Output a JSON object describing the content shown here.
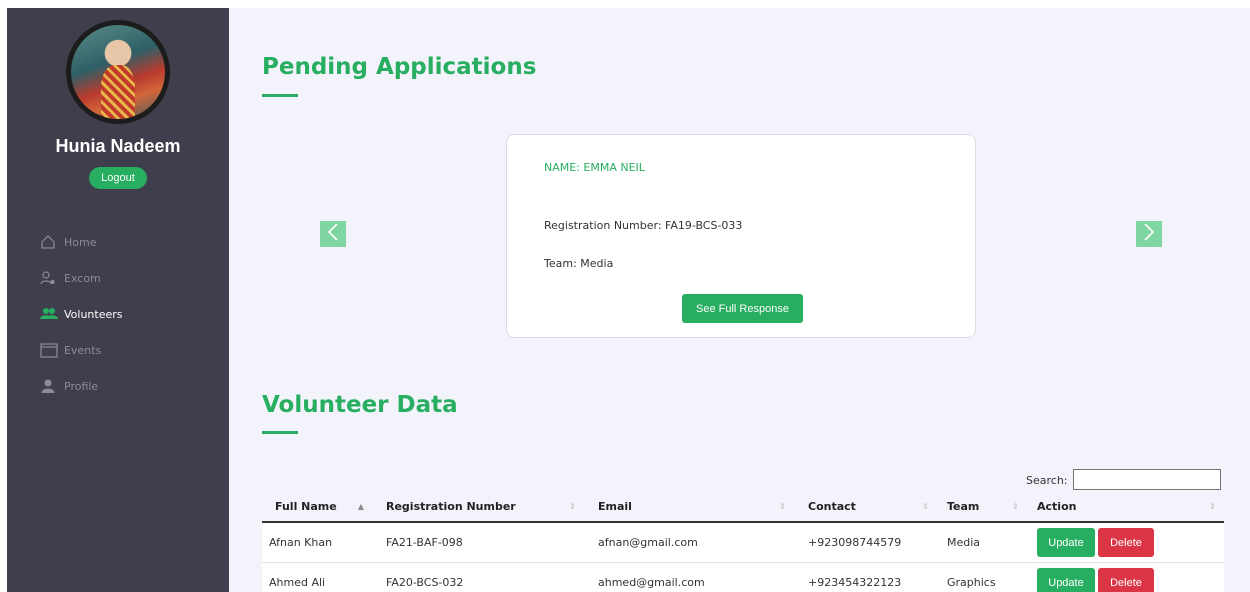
{
  "sidebar": {
    "user_name": "Hunia Nadeem",
    "logout_label": "Logout",
    "nav": [
      {
        "label": "Home",
        "icon": "home-icon",
        "active": false
      },
      {
        "label": "Excom",
        "icon": "users-gear-icon",
        "active": false
      },
      {
        "label": "Volunteers",
        "icon": "group-icon",
        "active": true
      },
      {
        "label": "Events",
        "icon": "calendar-icon",
        "active": false
      },
      {
        "label": "Profile",
        "icon": "user-icon",
        "active": false
      }
    ]
  },
  "pending": {
    "title": "Pending Applications",
    "card": {
      "name": "NAME: EMMA NEIL",
      "registration": "Registration Number: FA19-BCS-033",
      "team": "Team: Media",
      "button_label": "See Full Response"
    },
    "prev_icon": "chevron-left-icon",
    "next_icon": "chevron-right-icon"
  },
  "volunteers": {
    "title": "Volunteer Data",
    "search_label": "Search:",
    "search_value": "",
    "columns": [
      "Full Name",
      "Registration Number",
      "Email",
      "Contact",
      "Team",
      "Action"
    ],
    "rows": [
      {
        "name": "Afnan Khan",
        "reg": "FA21-BAF-098",
        "email": "afnan@gmail.com",
        "contact": "+923098744579",
        "team": "Media"
      },
      {
        "name": "Ahmed Ali",
        "reg": "FA20-BCS-032",
        "email": "ahmed@gmail.com",
        "contact": "+923454322123",
        "team": "Graphics"
      }
    ],
    "update_label": "Update",
    "delete_label": "Delete"
  },
  "colors": {
    "accent": "#27ae60",
    "sidebar_bg": "#3f3e4c",
    "danger": "#dc3545"
  }
}
